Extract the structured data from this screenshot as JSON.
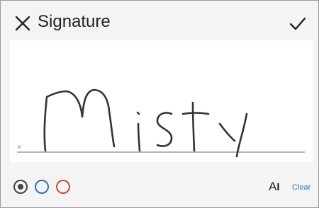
{
  "dialog": {
    "title": "Signature"
  },
  "icons": {
    "close": "close-icon",
    "confirm": "checkmark-icon",
    "font": "text-cursor-icon"
  },
  "canvas": {
    "baseline_marker": "x",
    "signature_text": "Misty"
  },
  "pen_colors": [
    {
      "name": "black",
      "color": "#444444",
      "selected": true
    },
    {
      "name": "blue",
      "color": "#2e74b5",
      "selected": false
    },
    {
      "name": "red",
      "color": "#d9423a",
      "selected": false
    }
  ],
  "toolbar": {
    "font_button_letter": "A",
    "clear_label": "Clear"
  },
  "colors": {
    "accent": "#2e74b5",
    "ink": "#333333"
  }
}
